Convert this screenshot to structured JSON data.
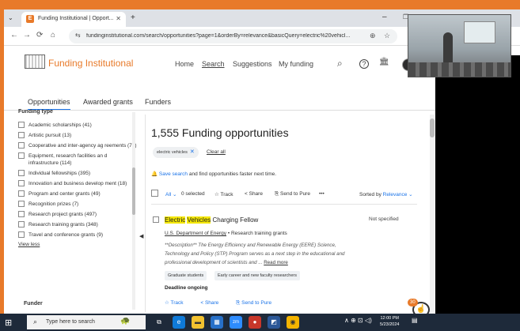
{
  "browser": {
    "tab_title": "Funding Institutional | Opport...",
    "tab_dropdown_icon": "chevron-down-icon",
    "favicon_letter": "E",
    "tab_close_glyph": "✕",
    "new_tab_glyph": "+",
    "minimize_glyph": "–",
    "maximize_glyph": "❐",
    "back_glyph": "←",
    "forward_glyph": "→",
    "reload_glyph": "⟳",
    "home_glyph": "⌂",
    "site_info_glyph": "⇆",
    "url": "fundinginstitutional.com/search/opportunities?page=1&orderBy=relevance&basicQuery=electric%20vehicl...",
    "zoom_glyph": "⊕",
    "star_glyph": "☆"
  },
  "site": {
    "logo_text": "Funding Institutional",
    "nav": [
      "Home",
      "Search",
      "Suggestions",
      "My funding"
    ],
    "active_nav": "Search",
    "header_icons": {
      "search": "⌕",
      "help": "?",
      "institution": "🏛"
    },
    "subnav": [
      "Opportunities",
      "Awarded grants",
      "Funders"
    ],
    "accent_color": "#e87a2a",
    "link_color": "#1a73e8"
  },
  "sidebar": {
    "heading": "Funding type",
    "items": [
      "Academic scholarships (41)",
      "Artistic pursuit (13)",
      "Cooperative and inter-agency ag reements (79)",
      "Equipment, research facilities an d infrastructure (114)",
      "Individual fellowships (395)",
      "Innovation and business develop ment (18)",
      "Program and center grants (49)",
      "Recognition prizes (7)",
      "Research project grants (497)",
      "Research training grants (348)",
      "Travel and conference grants (9)"
    ],
    "view_less": "View less",
    "funder_heading": "Funder",
    "collapse_glyph": "◀"
  },
  "main": {
    "results_title": "1,555 Funding opportunities",
    "chip_label": "electric vehicles",
    "chip_close": "✕",
    "clear_all": "Clear all",
    "save_search_link": "Save search",
    "save_search_text": " and find opportunities faster next time.",
    "save_search_icon": "🔔",
    "toolbar": {
      "all": "All",
      "selected": "0 selected",
      "track": "Track",
      "share": "Share",
      "send": "Send to Pure",
      "more": "•••",
      "sorted_by": "Sorted by",
      "sort_value": "Relevance"
    },
    "result": {
      "title_hl1": "Electric",
      "title_hl2": "Vehicles",
      "title_rest": " Charging Fellow",
      "status": "Not specified",
      "funder": "U.S. Department of Energy",
      "separator": " • ",
      "type": "Research training grants",
      "description": "**Description** The Energy Efficiency and Renewable Energy (EERE) Science, Technology and Policy (STP) Program serves as a next step in the educational and professional development of scientists and ...",
      "read_more": "Read more",
      "tags": [
        "Graduate students",
        "Early career and new faculty researchers"
      ],
      "deadline": "Deadline ongoing",
      "actions": [
        "Track",
        "Share",
        "Send to Pure"
      ]
    },
    "notification_count": "30"
  },
  "taskbar": {
    "search_placeholder": "Type here to search",
    "time": "12:00 PM",
    "date": "5/23/2024",
    "tray_glyphs": "∧ ⊕ ⊡ ◁)"
  }
}
